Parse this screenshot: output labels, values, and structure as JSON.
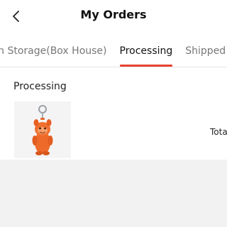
{
  "header": {
    "title": "My Orders",
    "back_icon": "chevron-left-icon"
  },
  "tabs": [
    {
      "label": "In Storage(Box House)",
      "active": false
    },
    {
      "label": "Processing",
      "active": true
    },
    {
      "label": "Shipped",
      "active": false
    }
  ],
  "order": {
    "section_title": "Processing",
    "product_image": "orange-figure-keychain",
    "total_label": "Total"
  },
  "colors": {
    "accent": "#e8432e",
    "product_orange": "#ee6a2a"
  }
}
